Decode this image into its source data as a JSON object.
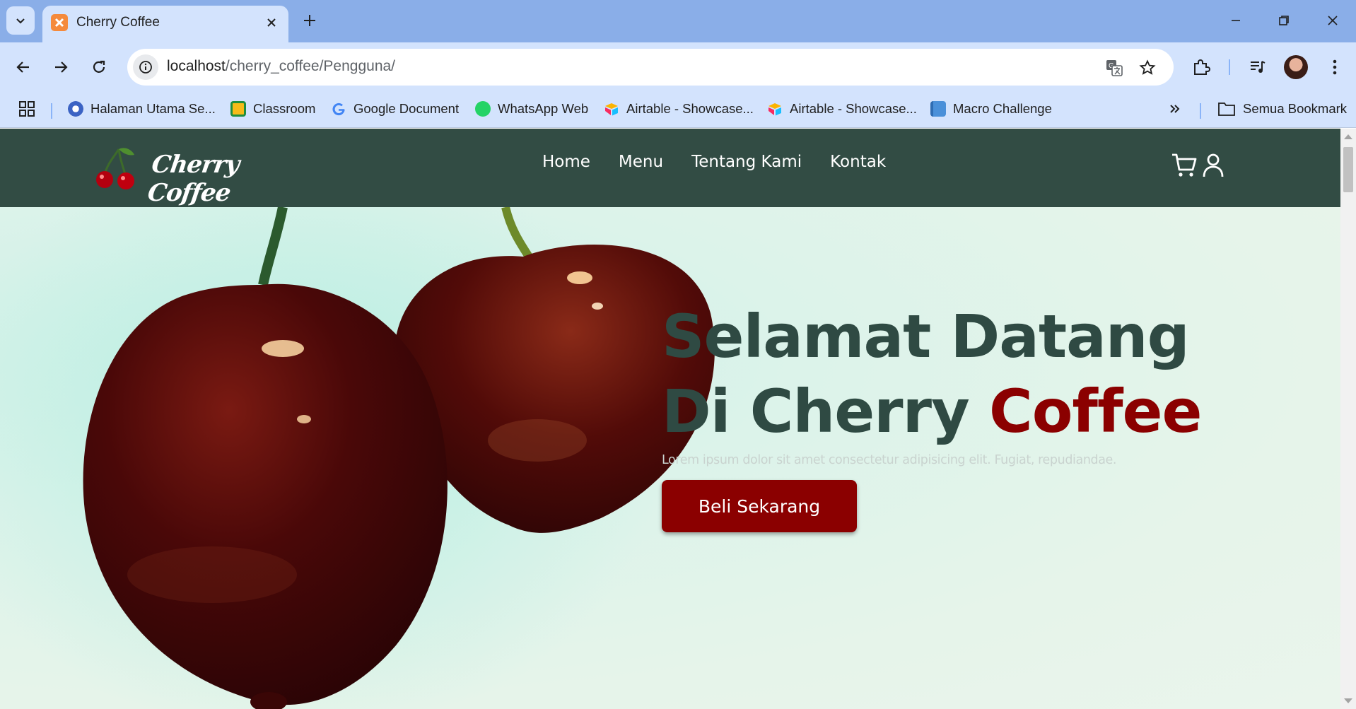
{
  "browser": {
    "tab": {
      "title": "Cherry Coffee"
    },
    "url": {
      "host": "localhost",
      "path": "/cherry_coffee/Pengguna/"
    },
    "bookmarks": [
      {
        "label": "Halaman Utama Se...",
        "icon": "institution-logo-icon",
        "color": "#3b63c4"
      },
      {
        "label": "Classroom",
        "icon": "classroom-icon",
        "color": "#f6bb18"
      },
      {
        "label": "Google Document",
        "icon": "google-icon",
        "color": "#4285f4"
      },
      {
        "label": "WhatsApp Web",
        "icon": "whatsapp-icon",
        "color": "#25d366"
      },
      {
        "label": "Airtable - Showcase...",
        "icon": "airtable-icon",
        "color": "#fcb400"
      },
      {
        "label": "Airtable - Showcase...",
        "icon": "airtable-icon",
        "color": "#fcb400"
      },
      {
        "label": "Macro Challenge",
        "icon": "book-icon",
        "color": "#4a90d9"
      }
    ],
    "all_bookmarks": "Semua Bookmark"
  },
  "site": {
    "brand": "Cherry Coffee",
    "nav": [
      "Home",
      "Menu",
      "Tentang Kami",
      "Kontak"
    ],
    "hero": {
      "title_line1": "Selamat Datang",
      "title_line2_prefix": "Di Cherry ",
      "title_line2_accent": "Coffee",
      "subtitle": "Lorem ipsum dolor sit amet consectetur adipisicing elit. Fugiat, repudiandae.",
      "cta": "Beli Sekarang"
    },
    "colors": {
      "header": "#324c44",
      "accent": "#8b0000",
      "title": "#2f4a43"
    }
  }
}
